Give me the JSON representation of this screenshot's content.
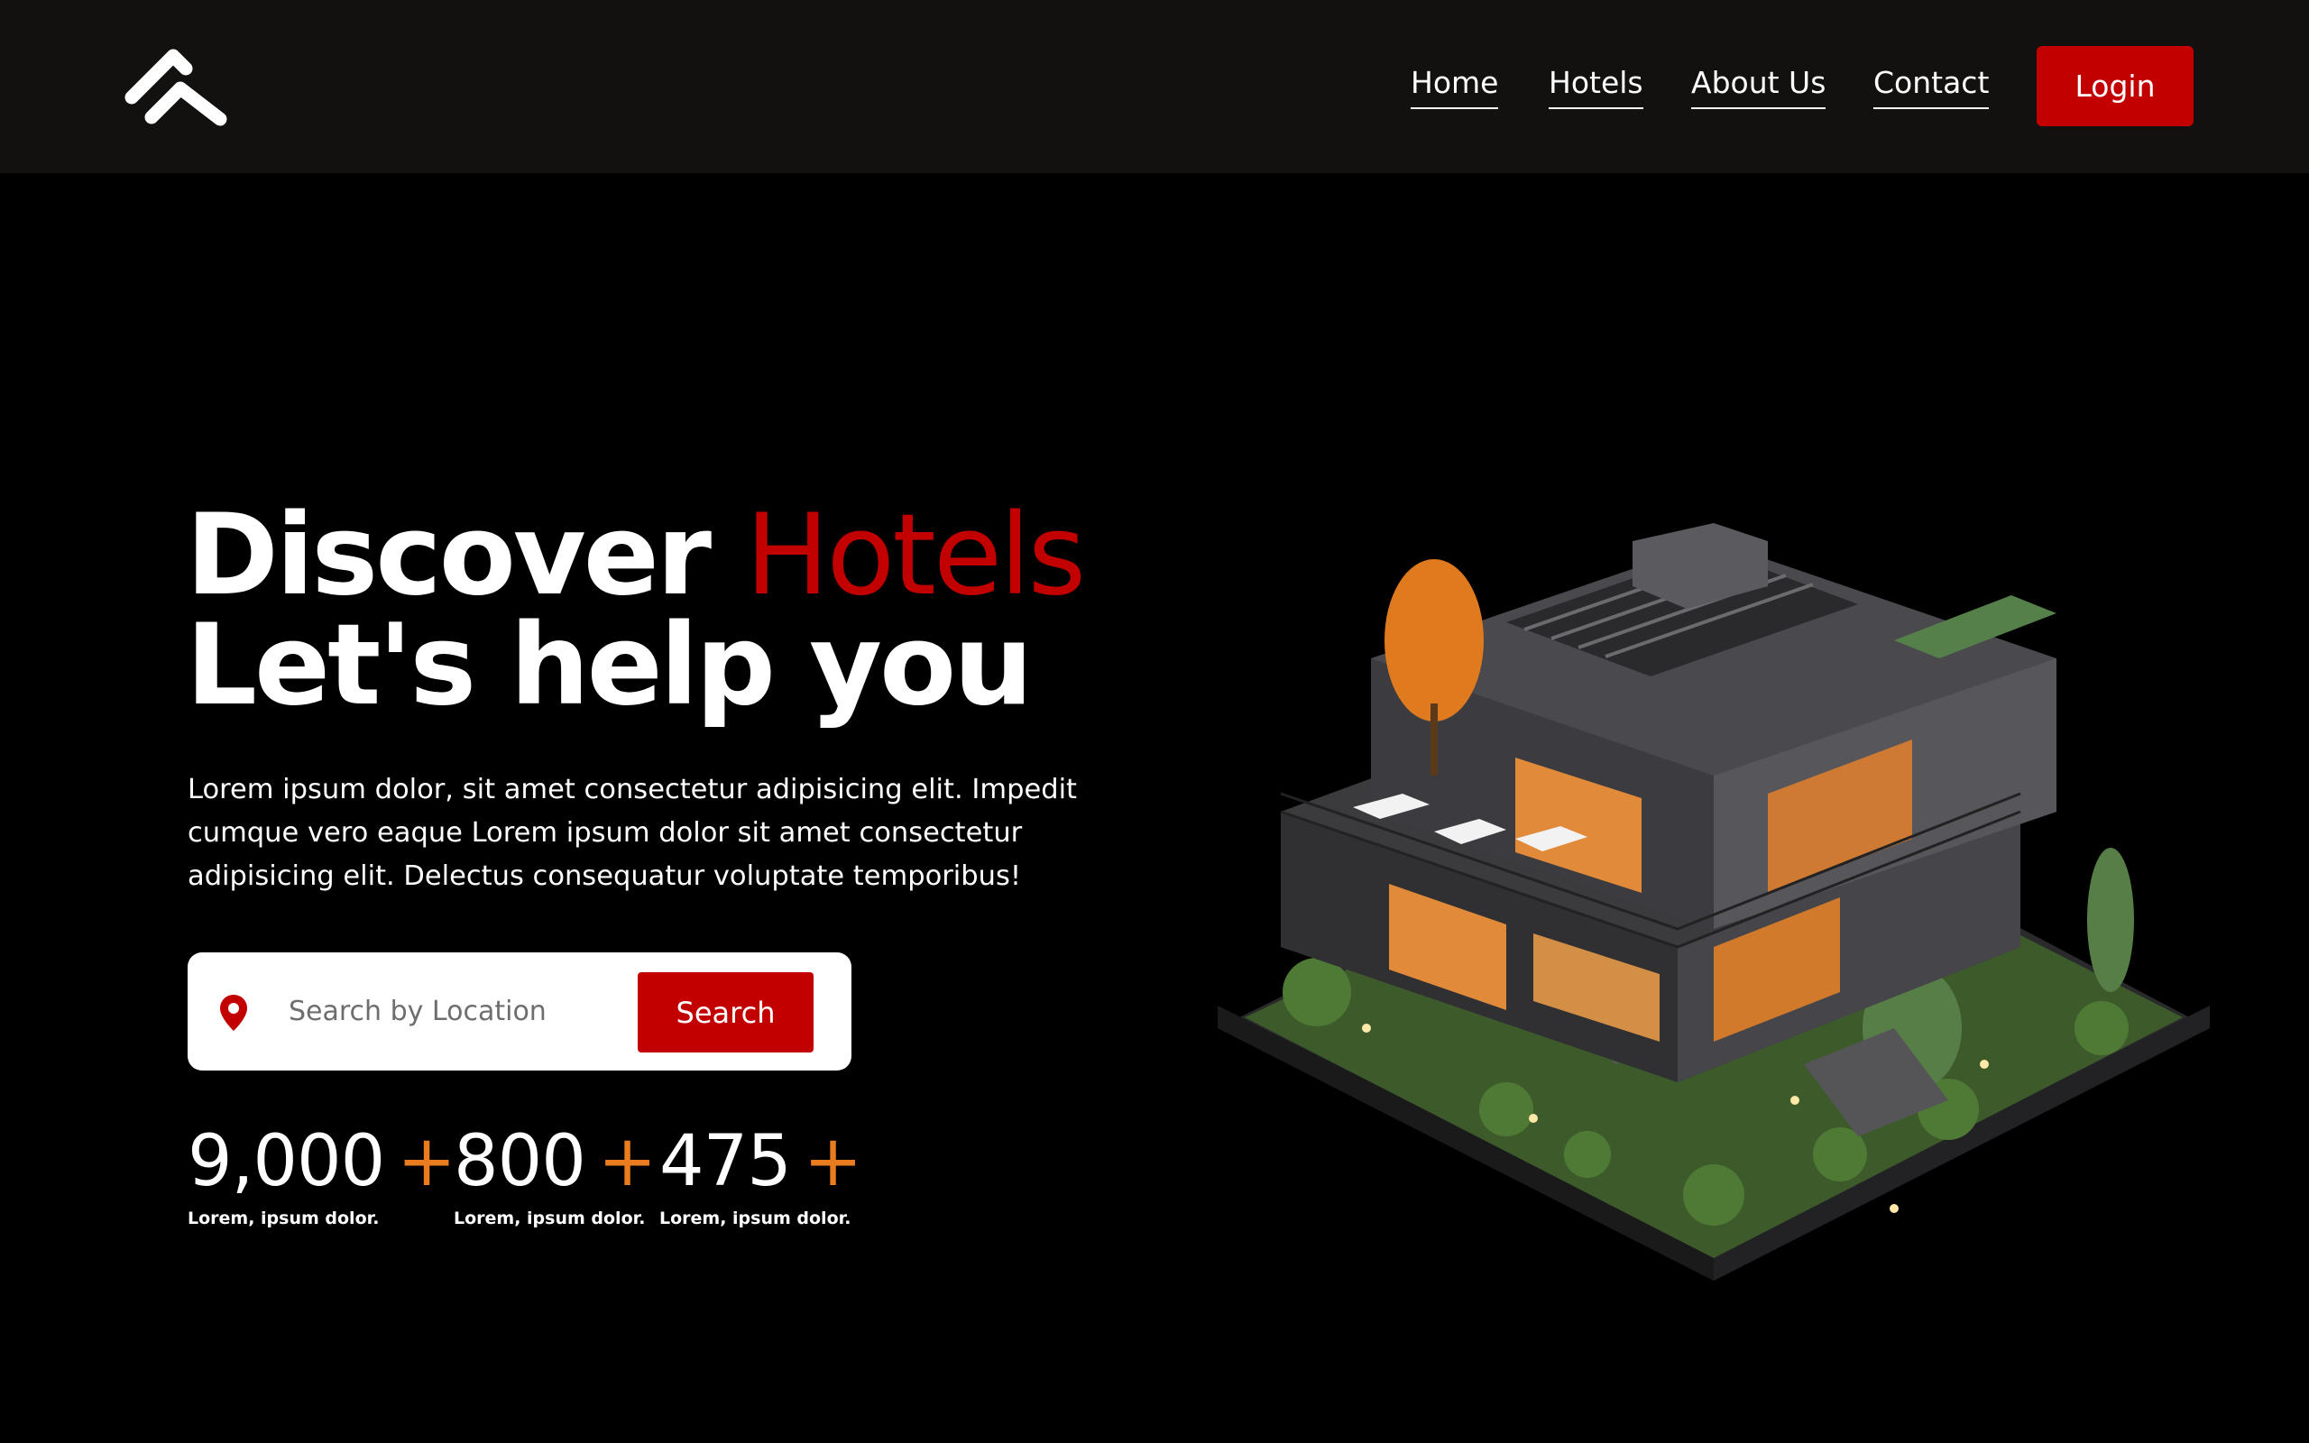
{
  "nav": {
    "items": [
      {
        "label": "Home"
      },
      {
        "label": "Hotels"
      },
      {
        "label": "About Us"
      },
      {
        "label": "Contact"
      }
    ],
    "login_label": "Login"
  },
  "hero": {
    "title_line1_plain": "Discover ",
    "title_line1_accent": "Hotels",
    "title_line2": "Let's help you",
    "description": "Lorem ipsum dolor, sit amet consectetur adipisicing elit. Impedit cumque vero eaque Lorem ipsum dolor sit amet consectetur adipisicing elit. Delectus consequatur voluptate temporibus!"
  },
  "search": {
    "placeholder": "Search by Location",
    "button_label": "Search",
    "icon": "location-pin-icon"
  },
  "stats": [
    {
      "value": "9,000",
      "plus": "+",
      "label": "Lorem, ipsum dolor."
    },
    {
      "value": "800",
      "plus": "+",
      "label": "Lorem, ipsum dolor."
    },
    {
      "value": "475",
      "plus": "+",
      "label": "Lorem, ipsum dolor."
    }
  ],
  "colors": {
    "accent": "#c20000",
    "stat_plus": "#e87c1e",
    "navbar_bg": "#121110",
    "page_bg": "#000000"
  }
}
